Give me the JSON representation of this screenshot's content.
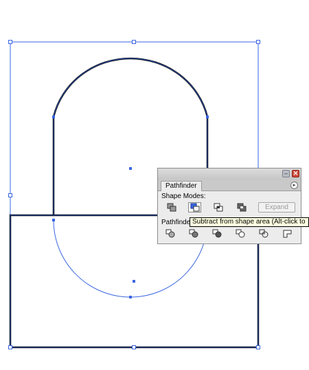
{
  "panel": {
    "tab_label": "Pathfinder",
    "shape_modes_label": "Shape Modes:",
    "pathfinders_label": "Pathfinde",
    "expand_label": "Expand",
    "minimize_symbol": "–",
    "close_symbol": "✕",
    "menu_symbol": "▸",
    "shape_mode_buttons": [
      "add-to-shape-area",
      "subtract-from-shape-area",
      "intersect-shape-areas",
      "exclude-overlapping-shape-areas"
    ],
    "pathfinder_buttons": [
      "divide",
      "trim",
      "merge",
      "crop",
      "outline",
      "minus-back"
    ]
  },
  "tooltip": {
    "text": "Subtract from shape area (Alt-click to"
  },
  "colors": {
    "selection": "#3a66e0",
    "stroke": "#000000",
    "panel_bg": "#ececec",
    "tooltip_bg": "#ffffe1"
  }
}
